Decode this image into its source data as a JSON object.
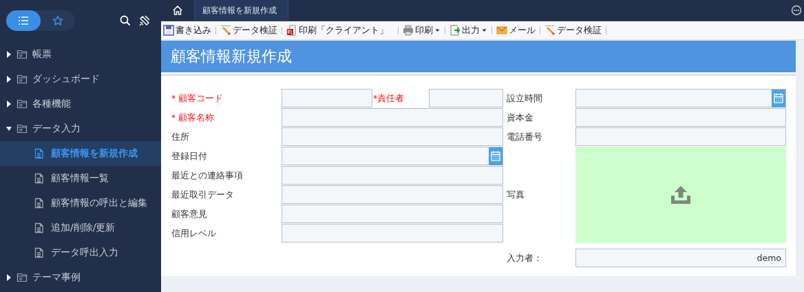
{
  "sidebar": {
    "view_toggle": [
      {
        "kind": "list",
        "selected": true
      },
      {
        "kind": "star",
        "selected": false
      }
    ],
    "tree": [
      {
        "label": "帳票",
        "expanded": false
      },
      {
        "label": "ダッシュボード",
        "expanded": false
      },
      {
        "label": "各種機能",
        "expanded": false
      },
      {
        "label": "データ入力",
        "expanded": true,
        "children": [
          {
            "label": "顧客情報を新規作成",
            "selected": true
          },
          {
            "label": "顧客情報一覧",
            "selected": false
          },
          {
            "label": "顧客情報の呼出と編集",
            "selected": false
          },
          {
            "label": "追加/削除/更新",
            "selected": false
          },
          {
            "label": "データ呼出入力",
            "selected": false
          }
        ]
      },
      {
        "label": "テーマ事例",
        "expanded": false
      }
    ]
  },
  "tabs": [
    {
      "label": "顧客情報を新規作成",
      "selected": true
    }
  ],
  "toolbar": [
    {
      "kind": "save",
      "label": "書き込み"
    },
    {
      "kind": "verify",
      "label": "データ検証"
    },
    {
      "kind": "pdf",
      "label": "印刷「クライアント」"
    },
    {
      "kind": "print",
      "label": "印刷",
      "dropdown": true
    },
    {
      "kind": "export",
      "label": "出力",
      "dropdown": true
    },
    {
      "kind": "mail",
      "label": "メール"
    },
    {
      "kind": "verify",
      "label": "データ検証"
    }
  ],
  "page_title": "顧客情報新規作成",
  "form": {
    "left_rows": [
      {
        "label": "* 顧客コード",
        "required": true,
        "kind": "text",
        "extra": {
          "label": "*責任者",
          "required": true
        }
      },
      {
        "label": "* 顧客名称",
        "required": true,
        "kind": "text"
      },
      {
        "label": "住所",
        "required": false,
        "kind": "text"
      },
      {
        "label": "登録日付",
        "required": false,
        "kind": "date"
      },
      {
        "label": "最近との連絡事項",
        "required": false,
        "kind": "text"
      },
      {
        "label": "最近取引データ",
        "required": false,
        "kind": "text"
      },
      {
        "label": "顧客意見",
        "required": false,
        "kind": "text"
      },
      {
        "label": "信用レベル",
        "required": false,
        "kind": "text"
      }
    ],
    "right_rows": [
      {
        "label": "設立時間",
        "kind": "date"
      },
      {
        "label": "資本金",
        "kind": "text"
      },
      {
        "label": "電話番号",
        "kind": "text"
      },
      {
        "label": "写真",
        "kind": "photo"
      }
    ],
    "entered_by": {
      "label": "入力者：",
      "value": "demo"
    }
  }
}
